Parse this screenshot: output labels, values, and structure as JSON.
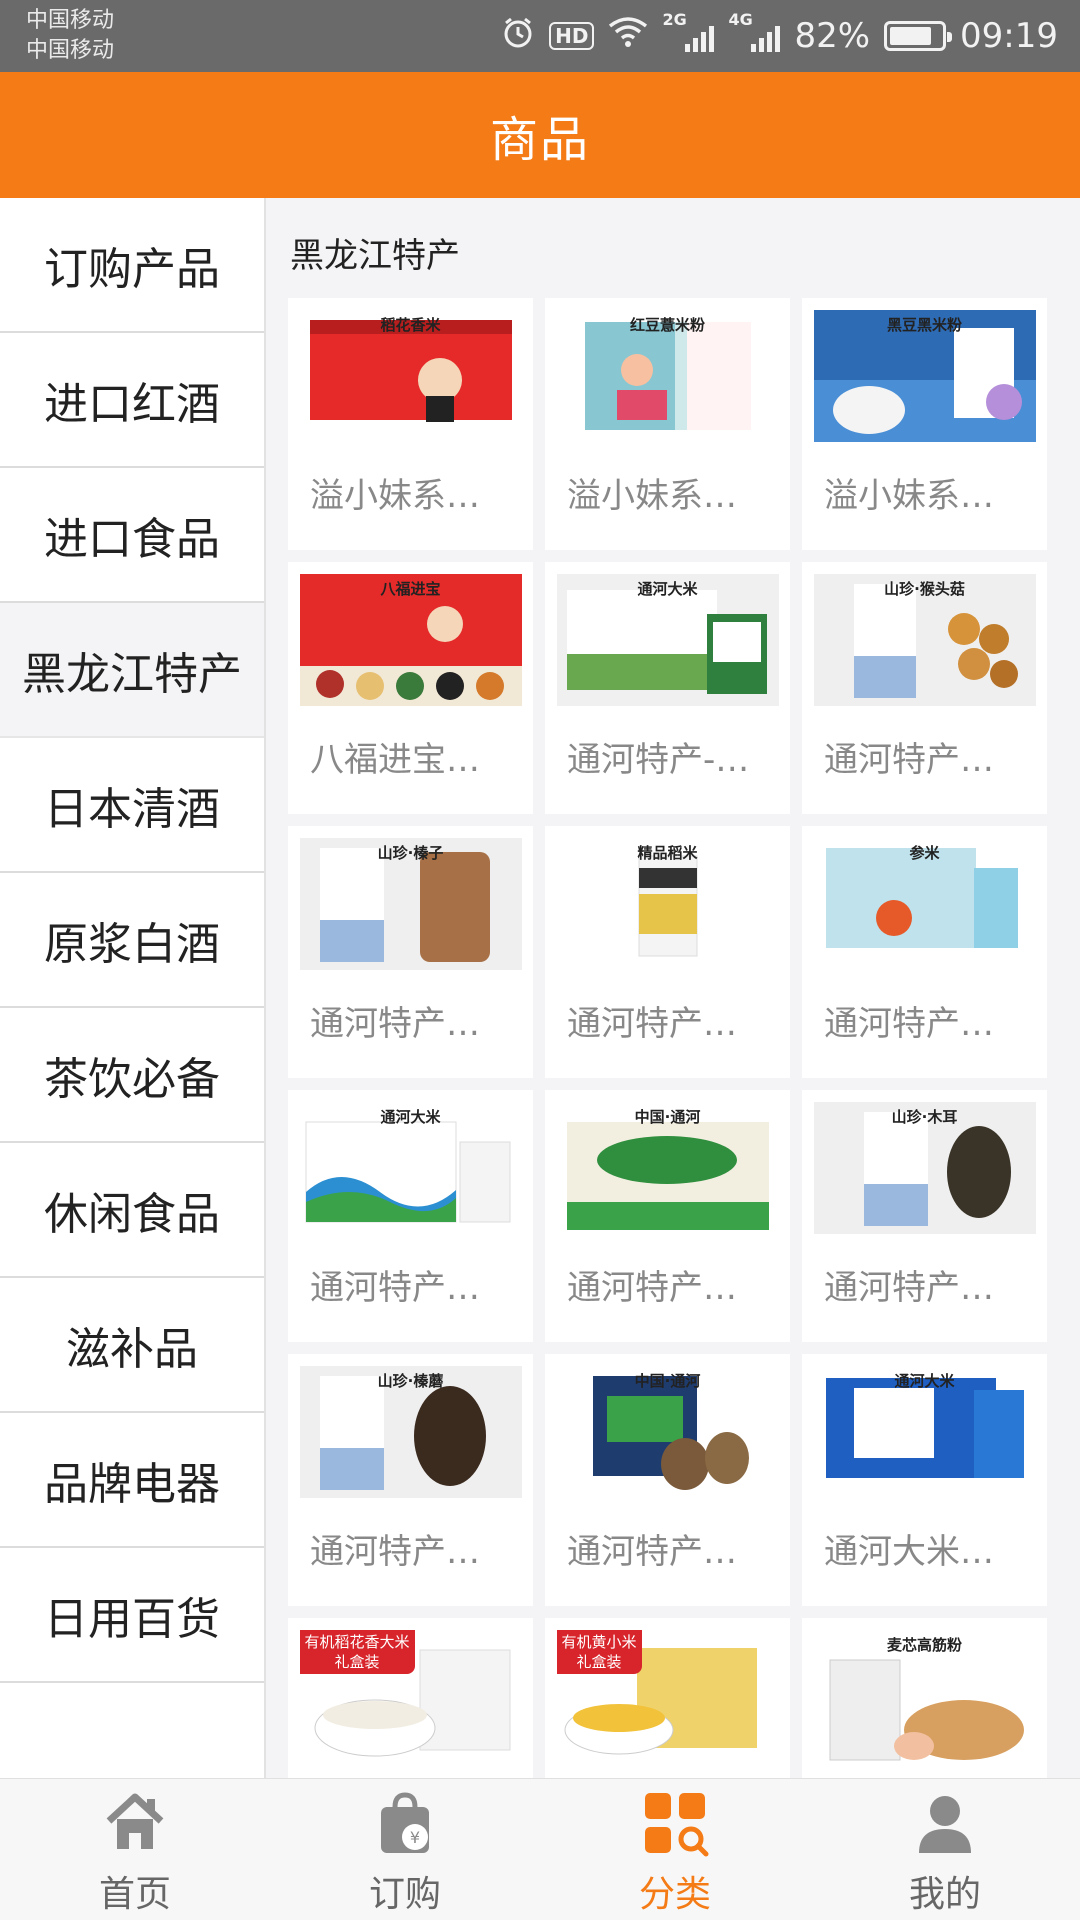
{
  "status_bar": {
    "carrier1": "中国移动",
    "carrier2": "中国移动",
    "hd": "HD",
    "net1": "2G",
    "net2": "4G",
    "battery": "82%",
    "battery_level": 0.82,
    "time": "09:19",
    "icons": [
      "alarm-icon",
      "wifi-icon",
      "signal-icon",
      "battery-icon"
    ]
  },
  "header": {
    "title": "商品"
  },
  "sidebar": {
    "items": [
      {
        "label": "订购产品",
        "active": false
      },
      {
        "label": "进口红酒",
        "active": false
      },
      {
        "label": "进口食品",
        "active": false
      },
      {
        "label": "黑龙江特产",
        "active": true
      },
      {
        "label": "日本清酒",
        "active": false
      },
      {
        "label": "原浆白酒",
        "active": false
      },
      {
        "label": "茶饮必备",
        "active": false
      },
      {
        "label": "休闲食品",
        "active": false
      },
      {
        "label": "滋补品",
        "active": false
      },
      {
        "label": "品牌电器",
        "active": false
      },
      {
        "label": "日用百货",
        "active": false
      }
    ]
  },
  "main": {
    "section_title": "黑龙江特产",
    "products": [
      {
        "name": "溢小妹系列稻花香米",
        "img_text": "稻花香米",
        "badge": ""
      },
      {
        "name": "溢小妹系列红豆薏米粉",
        "img_text": "红豆薏米粉",
        "badge": ""
      },
      {
        "name": "溢小妹系列黑豆黑米粉",
        "img_text": "黑豆黑米粉",
        "badge": ""
      },
      {
        "name": "八福进宝有机杂粮",
        "img_text": "八福进宝",
        "badge": ""
      },
      {
        "name": "通河特产-蟹稻共生大米",
        "img_text": "通河大米",
        "badge": ""
      },
      {
        "name": "通河特产山珍猴头菇",
        "img_text": "山珍·猴头菇",
        "badge": ""
      },
      {
        "name": "通河特产山珍榛子",
        "img_text": "山珍·榛子",
        "badge": ""
      },
      {
        "name": "通河特产精品稻米",
        "img_text": "精品稻米",
        "badge": ""
      },
      {
        "name": "通河特产参米",
        "img_text": "参米",
        "badge": ""
      },
      {
        "name": "通河特产泽润大米",
        "img_text": "通河大米",
        "badge": ""
      },
      {
        "name": "通河特产五谷杂粮",
        "img_text": "中国·通河",
        "badge": ""
      },
      {
        "name": "通河特产山珍木耳",
        "img_text": "山珍·木耳",
        "badge": ""
      },
      {
        "name": "通河特产山珍榛蘑",
        "img_text": "山珍·榛蘑",
        "badge": ""
      },
      {
        "name": "通河特产蓝莓酱",
        "img_text": "中国·通河",
        "badge": ""
      },
      {
        "name": "通河大米鸭稻共生",
        "img_text": "通河大米",
        "badge": ""
      },
      {
        "name": "",
        "img_text": "",
        "badge": "有机稻花香大米\n礼盒装"
      },
      {
        "name": "",
        "img_text": "",
        "badge": "有机黄小米\n礼盒装"
      },
      {
        "name": "",
        "img_text": "麦芯高筋粉",
        "badge": ""
      }
    ]
  },
  "bottom_nav": {
    "items": [
      {
        "label": "首页",
        "icon": "home-icon",
        "active": false
      },
      {
        "label": "订购",
        "icon": "shopping-bag-icon",
        "active": false
      },
      {
        "label": "分类",
        "icon": "category-icon",
        "active": true
      },
      {
        "label": "我的",
        "icon": "user-icon",
        "active": false
      }
    ]
  },
  "colors": {
    "accent": "#f47b16",
    "status_bg": "#6a6a6a",
    "inactive_nav": "#8a8a8a"
  }
}
